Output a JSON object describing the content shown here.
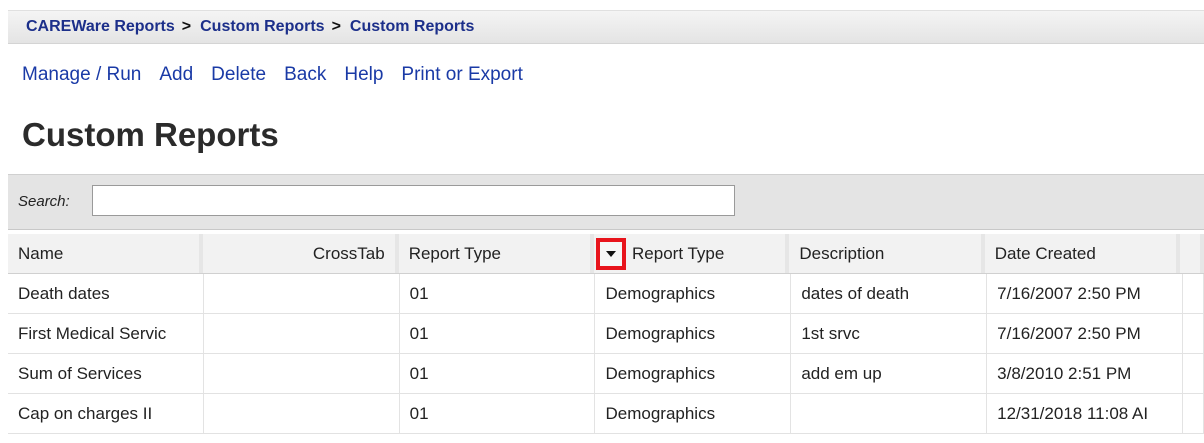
{
  "breadcrumb": [
    "CAREWare Reports",
    "Custom Reports",
    "Custom Reports"
  ],
  "breadcrumb_separator": ">",
  "menu": [
    "Manage / Run",
    "Add",
    "Delete",
    "Back",
    "Help",
    "Print or Export"
  ],
  "page_title": "Custom Reports",
  "search": {
    "label": "Search:",
    "value": "",
    "placeholder": ""
  },
  "table": {
    "columns": [
      "Name",
      "CrossTab",
      "Report Type",
      "Report Type",
      "Description",
      "Date Created"
    ],
    "rows": [
      [
        "Death dates",
        "",
        "01",
        "Demographics",
        "dates of death",
        "7/16/2007 2:50 PM"
      ],
      [
        "First Medical Servic",
        "",
        "01",
        "Demographics",
        "1st srvc",
        "7/16/2007 2:50 PM"
      ],
      [
        "Sum of Services",
        "",
        "01",
        "Demographics",
        "add em up",
        "3/8/2010 2:51 PM"
      ],
      [
        "Cap on charges II",
        "",
        "01",
        "Demographics",
        "",
        "12/31/2018 11:08 AI"
      ]
    ]
  },
  "icons": {
    "column_dropdown": "chevron-down-icon"
  },
  "colors": {
    "link": "#1a3aa6",
    "breadcrumb": "#1c2f8a",
    "highlight_box": "#e8141c"
  }
}
